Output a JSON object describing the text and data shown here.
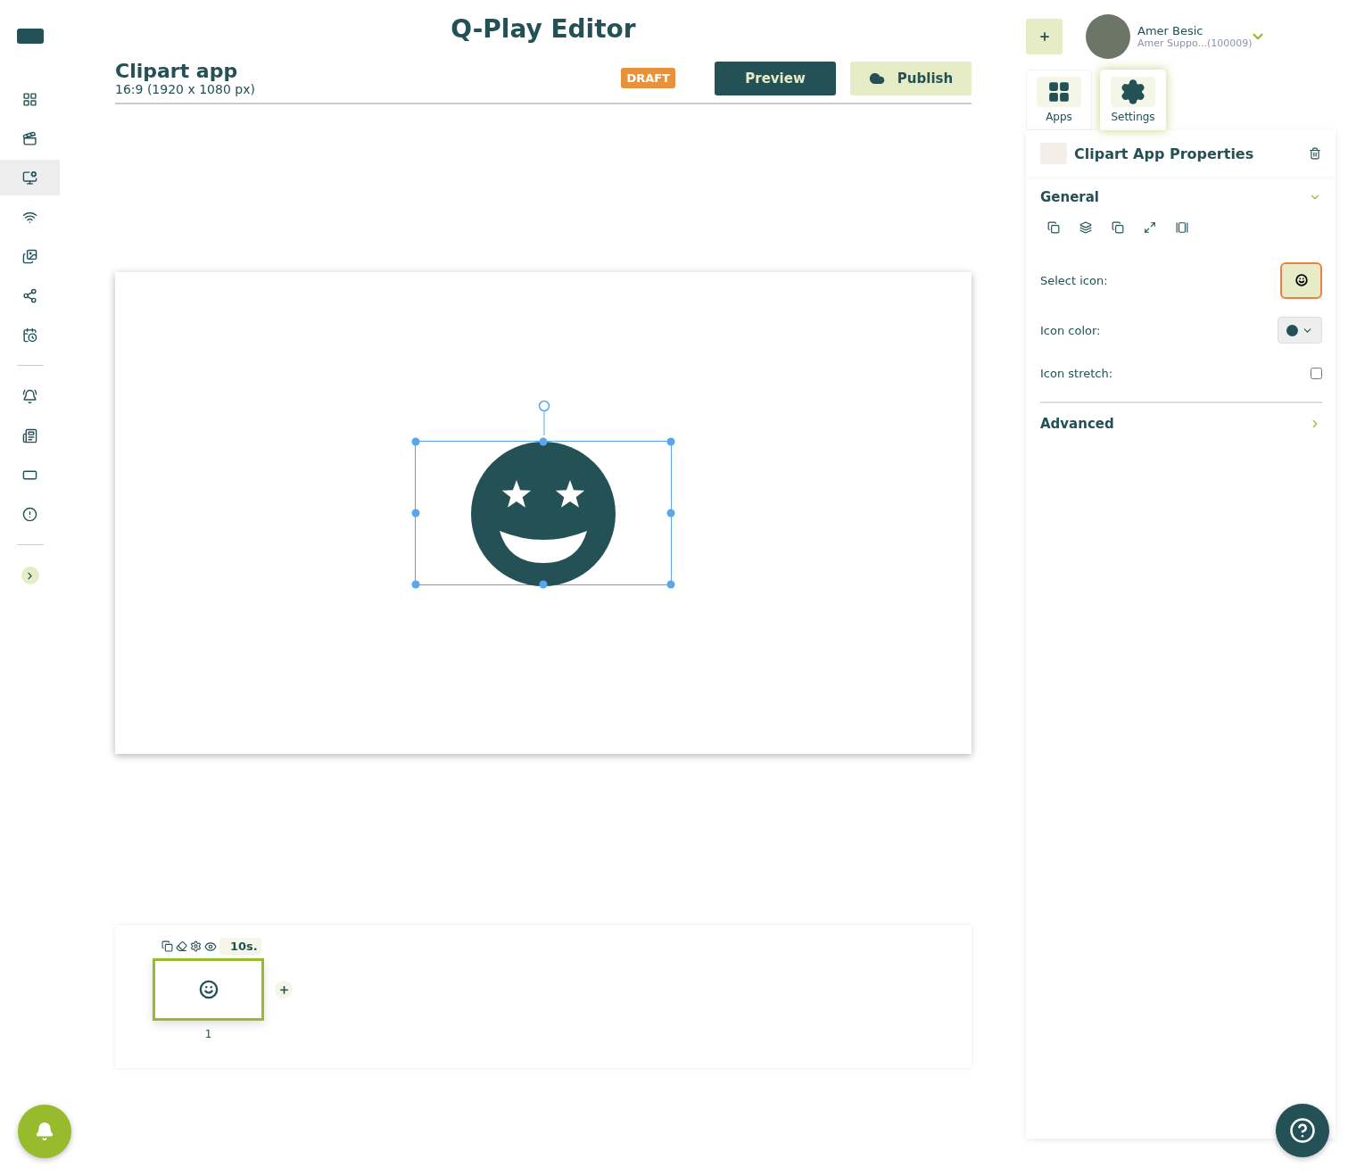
{
  "app_title": "Q-Play Editor",
  "sidebar": {
    "items": [
      {
        "kind": "dashboard",
        "selected": false
      },
      {
        "kind": "media",
        "selected": false
      },
      {
        "kind": "editor",
        "selected": true
      },
      {
        "kind": "wifi",
        "selected": false
      },
      {
        "kind": "gallery",
        "selected": false
      },
      {
        "kind": "share",
        "selected": false
      },
      {
        "kind": "schedule",
        "selected": false
      },
      {
        "kind": "divider"
      },
      {
        "kind": "alarm",
        "selected": false
      },
      {
        "kind": "news",
        "selected": false
      },
      {
        "kind": "screen",
        "selected": false
      },
      {
        "kind": "alert",
        "selected": false
      },
      {
        "kind": "divider"
      },
      {
        "kind": "expand"
      }
    ]
  },
  "header": {
    "title": "Clipart app",
    "subtitle": "16:9 (1920 x 1080 px)",
    "status": "DRAFT",
    "preview": "Preview",
    "publish": "Publish"
  },
  "user": {
    "name": "Amer Besic",
    "account": "Amer Suppo...(100009)"
  },
  "panel_tabs": [
    {
      "label": "Apps",
      "kind": "apps",
      "selected": false
    },
    {
      "label": "Settings",
      "kind": "settings",
      "selected": true
    }
  ],
  "properties": {
    "title": "Clipart App Properties",
    "sections": [
      {
        "title": "General",
        "expanded": true
      },
      {
        "title": "Advanced",
        "expanded": false
      }
    ],
    "select_icon_label": "Select icon:",
    "icon_color_label": "Icon color:",
    "icon_stretch_label": "Icon stretch:",
    "icon_stretch": false
  },
  "timeline": {
    "slides": [
      {
        "duration": "10s.",
        "number": "1",
        "selected": true
      }
    ]
  }
}
